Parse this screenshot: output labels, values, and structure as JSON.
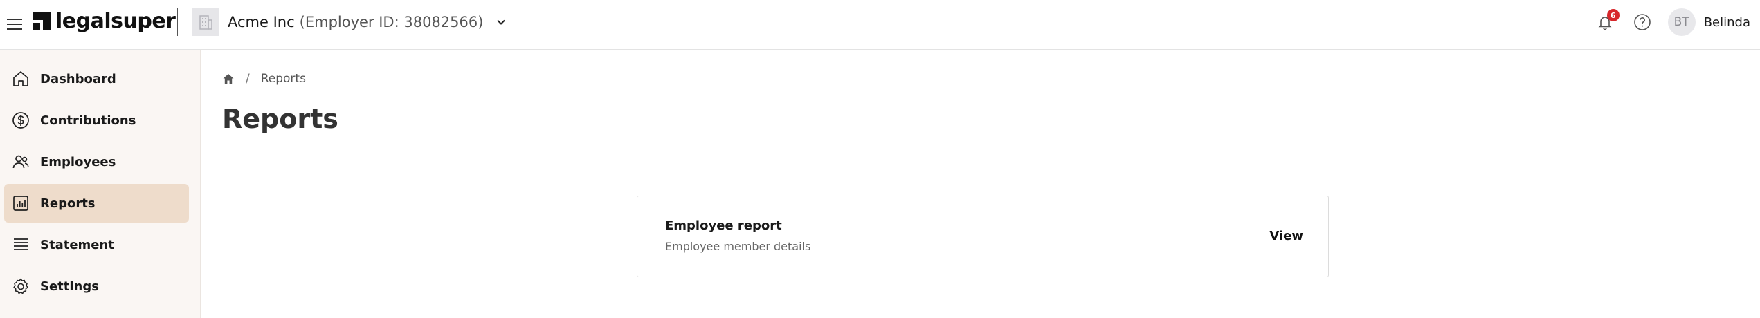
{
  "header": {
    "logo_text": "legalsuper",
    "employer_name": "Acme Inc",
    "employer_id": "(Employer ID: 38082566)",
    "notification_count": "6",
    "avatar_initials": "BT",
    "user_name": "Belinda"
  },
  "sidebar": {
    "items": [
      {
        "label": "Dashboard",
        "icon": "home-icon",
        "active": false
      },
      {
        "label": "Contributions",
        "icon": "dollar-circle-icon",
        "active": false
      },
      {
        "label": "Employees",
        "icon": "people-icon",
        "active": false
      },
      {
        "label": "Reports",
        "icon": "chart-icon",
        "active": true
      },
      {
        "label": "Statement",
        "icon": "list-icon",
        "active": false
      },
      {
        "label": "Settings",
        "icon": "gear-icon",
        "active": false
      }
    ]
  },
  "breadcrumb": {
    "separator": "/",
    "current": "Reports"
  },
  "page": {
    "title": "Reports"
  },
  "reports": [
    {
      "title": "Employee report",
      "description": "Employee member details",
      "action_label": "View"
    }
  ],
  "colors": {
    "sidebar_bg": "#faf6f3",
    "active_item_bg": "#eedccb",
    "badge": "#d7272b"
  }
}
